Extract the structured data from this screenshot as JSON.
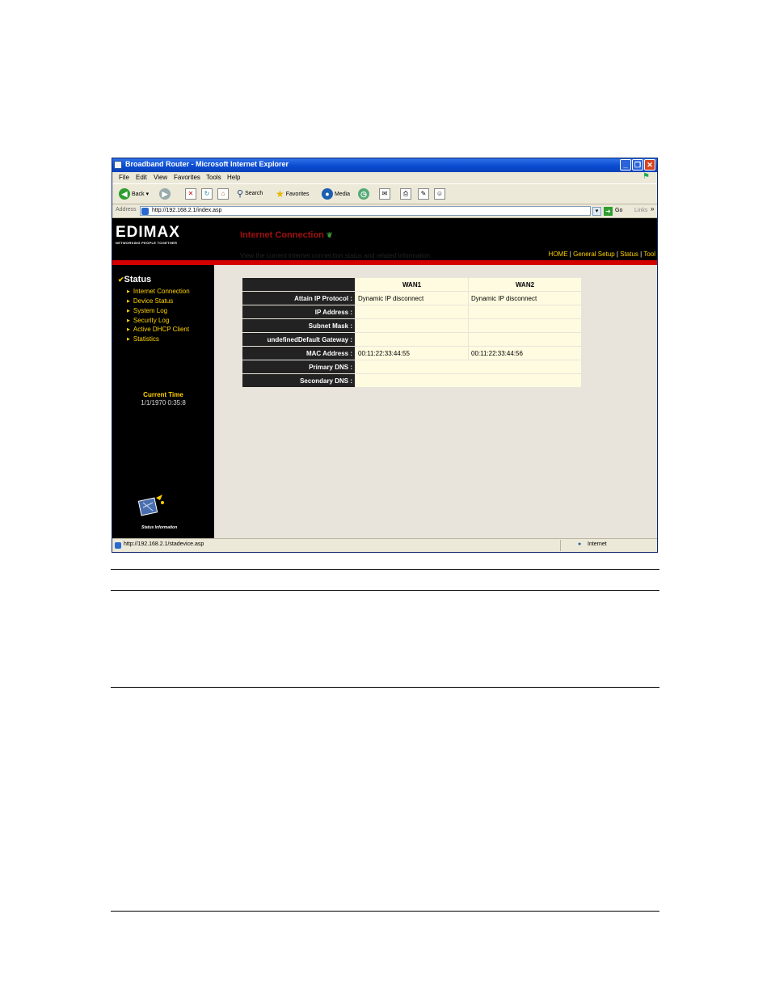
{
  "window": {
    "title": "Broadband Router - Microsoft Internet Explorer",
    "controls": {
      "minimize": "_",
      "restore": "❐",
      "close": "✕"
    }
  },
  "menu": [
    "File",
    "Edit",
    "View",
    "Favorites",
    "Tools",
    "Help"
  ],
  "toolbar": {
    "back": "Back",
    "search": "Search",
    "favorites": "Favorites",
    "media": "Media"
  },
  "address": {
    "label": "Address",
    "url": "http://192.168.2.1/index.asp",
    "go": "Go",
    "links": "Links"
  },
  "brand": {
    "logo": "EDIMAX",
    "tagline": "NETWORKING PEOPLE TOGETHER"
  },
  "topnav": {
    "home": "HOME",
    "general": "General Setup",
    "status": "Status",
    "tool": "Tool",
    "sep": "|"
  },
  "sidebar": {
    "title": "Status",
    "items": [
      {
        "label": "Internet Connection"
      },
      {
        "label": "Device Status"
      },
      {
        "label": "System Log"
      },
      {
        "label": "Security Log"
      },
      {
        "label": "Active DHCP Client"
      },
      {
        "label": "Statistics"
      }
    ],
    "current_time_label": "Current Time",
    "current_time_value": "1/1/1970 0:35:8",
    "status_info": "Status Information"
  },
  "content": {
    "title": "Internet Connection",
    "description": "View the current internet connection status and related information."
  },
  "table": {
    "headers": [
      "WAN1",
      "WAN2"
    ],
    "rows": [
      {
        "label": "Attain IP Protocol :",
        "wan1": "Dynamic IP disconnect",
        "wan2": "Dynamic IP disconnect"
      },
      {
        "label": "IP Address :",
        "wan1": "",
        "wan2": ""
      },
      {
        "label": "Subnet Mask :",
        "wan1": "",
        "wan2": ""
      },
      {
        "label": "undefinedDefault Gateway :",
        "wan1": "",
        "wan2": ""
      },
      {
        "label": "MAC Address :",
        "wan1": "00:11:22:33:44:55",
        "wan2": "00:11:22:33:44:56"
      },
      {
        "label": "Primary DNS :",
        "value": ""
      },
      {
        "label": "Secondary DNS :",
        "value": ""
      }
    ]
  },
  "statusbar": {
    "url": "http://192.168.2.1/stadevice.asp",
    "zone": "Internet"
  },
  "colors": {
    "accent": "#ffd200",
    "banner": "#000000",
    "redline": "#d40000",
    "title": "#a01010"
  }
}
